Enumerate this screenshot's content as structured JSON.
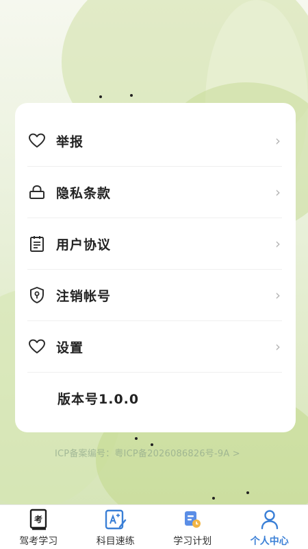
{
  "menu": {
    "items": [
      {
        "label": "举报",
        "icon": "heart-icon"
      },
      {
        "label": "隐私条款",
        "icon": "lock-icon"
      },
      {
        "label": "用户协议",
        "icon": "clipboard-icon"
      },
      {
        "label": "注销帐号",
        "icon": "shield-key-icon"
      },
      {
        "label": "设置",
        "icon": "heart-icon"
      }
    ],
    "chevron": "›",
    "version": "版本号1.0.0"
  },
  "footer": {
    "icp": "ICP备案编号：粤ICP备2026086826号-9A >"
  },
  "tabs": [
    {
      "label": "驾考学习",
      "icon": "exam-book-icon",
      "badge": "考"
    },
    {
      "label": "科目速练",
      "icon": "practice-icon"
    },
    {
      "label": "学习计划",
      "icon": "plan-icon"
    },
    {
      "label": "个人中心",
      "icon": "user-icon"
    }
  ],
  "colors": {
    "accent": "#3a7fd6",
    "card": "#ffffff",
    "background": "#e4edd0"
  }
}
